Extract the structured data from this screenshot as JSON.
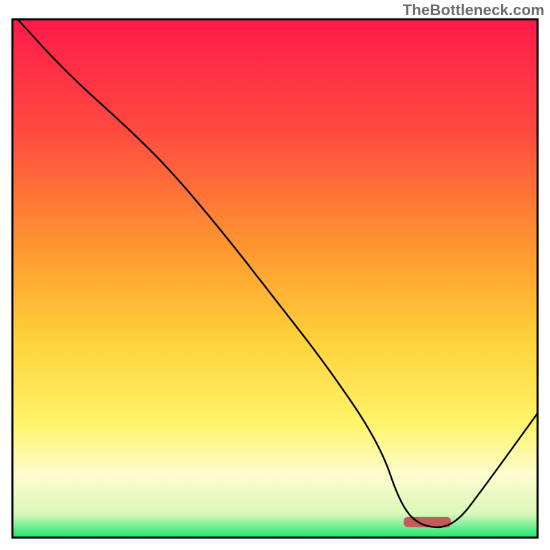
{
  "watermark": "TheBottleneck.com",
  "chart_data": {
    "type": "line",
    "title": "",
    "xlabel": "",
    "ylabel": "",
    "xlim": [
      0,
      100
    ],
    "ylim": [
      0,
      100
    ],
    "grid": false,
    "legend": false,
    "annotations": [],
    "background_gradient_stops": [
      {
        "offset": 0.0,
        "color": "#ff1a4b"
      },
      {
        "offset": 0.22,
        "color": "#ff4b3f"
      },
      {
        "offset": 0.45,
        "color": "#ff9a2f"
      },
      {
        "offset": 0.62,
        "color": "#ffd23a"
      },
      {
        "offset": 0.78,
        "color": "#fff46a"
      },
      {
        "offset": 0.88,
        "color": "#fdfccf"
      },
      {
        "offset": 0.955,
        "color": "#d9f7b8"
      },
      {
        "offset": 1.0,
        "color": "#17e670"
      }
    ],
    "marker": {
      "shape": "rounded-bar",
      "color": "#c55a5a",
      "x_center": 79,
      "width_x": 9,
      "y": 2,
      "height_y": 2
    },
    "series": [
      {
        "name": "curve",
        "color": "#000000",
        "stroke_width": 2.5,
        "x": [
          1,
          10,
          22,
          30,
          40,
          50,
          60,
          70,
          74,
          78,
          84,
          90,
          100
        ],
        "y": [
          100,
          90,
          79,
          71,
          59,
          46,
          33,
          18,
          6,
          2,
          2,
          10,
          24
        ]
      }
    ]
  }
}
